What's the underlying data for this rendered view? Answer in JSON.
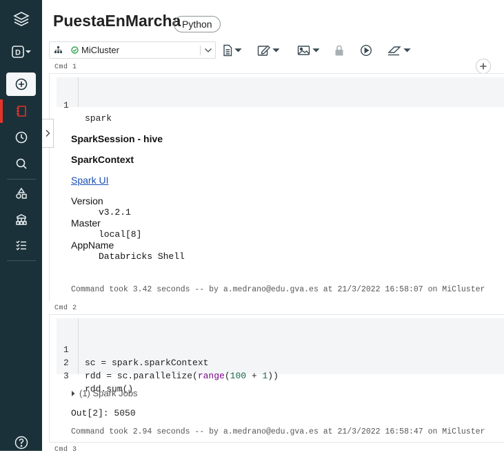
{
  "notebook": {
    "title": "PuestaEnMarcha",
    "language": "Python",
    "cluster_name": "MiCluster",
    "cluster_status_color": "#2ea44f"
  },
  "sidebar": {
    "items": [
      {
        "icon": "layers-icon"
      },
      {
        "icon": "workspace-switcher-icon",
        "letter": "D"
      },
      {
        "icon": "create-plus-icon"
      },
      {
        "icon": "notebook-icon"
      },
      {
        "icon": "recents-clock-icon"
      },
      {
        "icon": "search-icon"
      },
      {
        "icon": "shapes-icon"
      },
      {
        "icon": "cluster-tree-icon"
      },
      {
        "icon": "jobs-checklist-icon"
      },
      {
        "icon": "help-icon"
      }
    ],
    "accent": "#e5332a",
    "bg": "#1b3139"
  },
  "cells": [
    {
      "label": "Cmd 1",
      "lines": [
        {
          "n": "1",
          "code": "spark"
        }
      ],
      "output": {
        "heading1": "SparkSession - hive",
        "heading2": "SparkContext",
        "link": "Spark UI",
        "version_label": "Version",
        "version_value": "v3.2.1",
        "master_label": "Master",
        "master_value": "local[8]",
        "appname_label": "AppName",
        "appname_value": "Databricks Shell"
      },
      "took": "Command took 3.42 seconds -- by a.medrano@edu.gva.es at 21/3/2022 16:58:07 on MiCluster"
    },
    {
      "label": "Cmd 2",
      "lines": [
        {
          "n": "1",
          "code_a": "sc = spark.sparkContext"
        },
        {
          "n": "2",
          "code_a": "rdd = sc.parallelize(",
          "fn": "range",
          "mid": "(",
          "num1": "100",
          "op": " + ",
          "num2": "1",
          "end": "))"
        },
        {
          "n": "3",
          "code_a": "rdd.sum()"
        }
      ],
      "jobs": "(1) Spark Jobs",
      "out": "Out[2]: 5050",
      "took": "Command took 2.94 seconds -- by a.medrano@edu.gva.es at 21/3/2022 16:58:47 on MiCluster"
    },
    {
      "label": "Cmd 3"
    }
  ]
}
